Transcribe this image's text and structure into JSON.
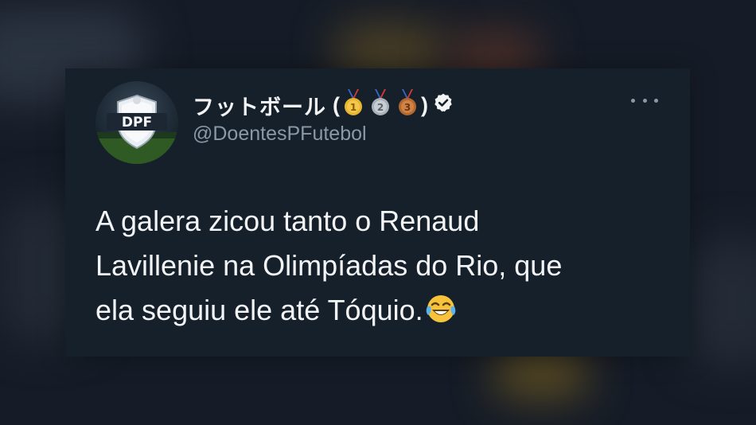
{
  "tweet": {
    "display_name": "フットボール",
    "paren_open": "(",
    "paren_close": ")",
    "medals": [
      {
        "icon": "gold-medal-icon",
        "number": "1",
        "color": "#e8b530"
      },
      {
        "icon": "silver-medal-icon",
        "number": "2",
        "color": "#b9c0c6"
      },
      {
        "icon": "bronze-medal-icon",
        "number": "3",
        "color": "#c2773d"
      }
    ],
    "verified_icon": "verified-badge-icon",
    "handle": "@DoentesPFutebol",
    "avatar_logo_text": "DPF",
    "text_lines": [
      "A galera zicou tanto o Renaud",
      "Lavillenie na Olimpíadas do Rio, que",
      "ela seguiu ele até Tóquio."
    ],
    "trailing_emoji": "face-with-tears-of-joy-icon",
    "more_icon": "more-options-icon"
  },
  "colors": {
    "card_bg": "#15202b",
    "text_primary": "#f2f4f6",
    "text_secondary": "#8b98a5"
  }
}
